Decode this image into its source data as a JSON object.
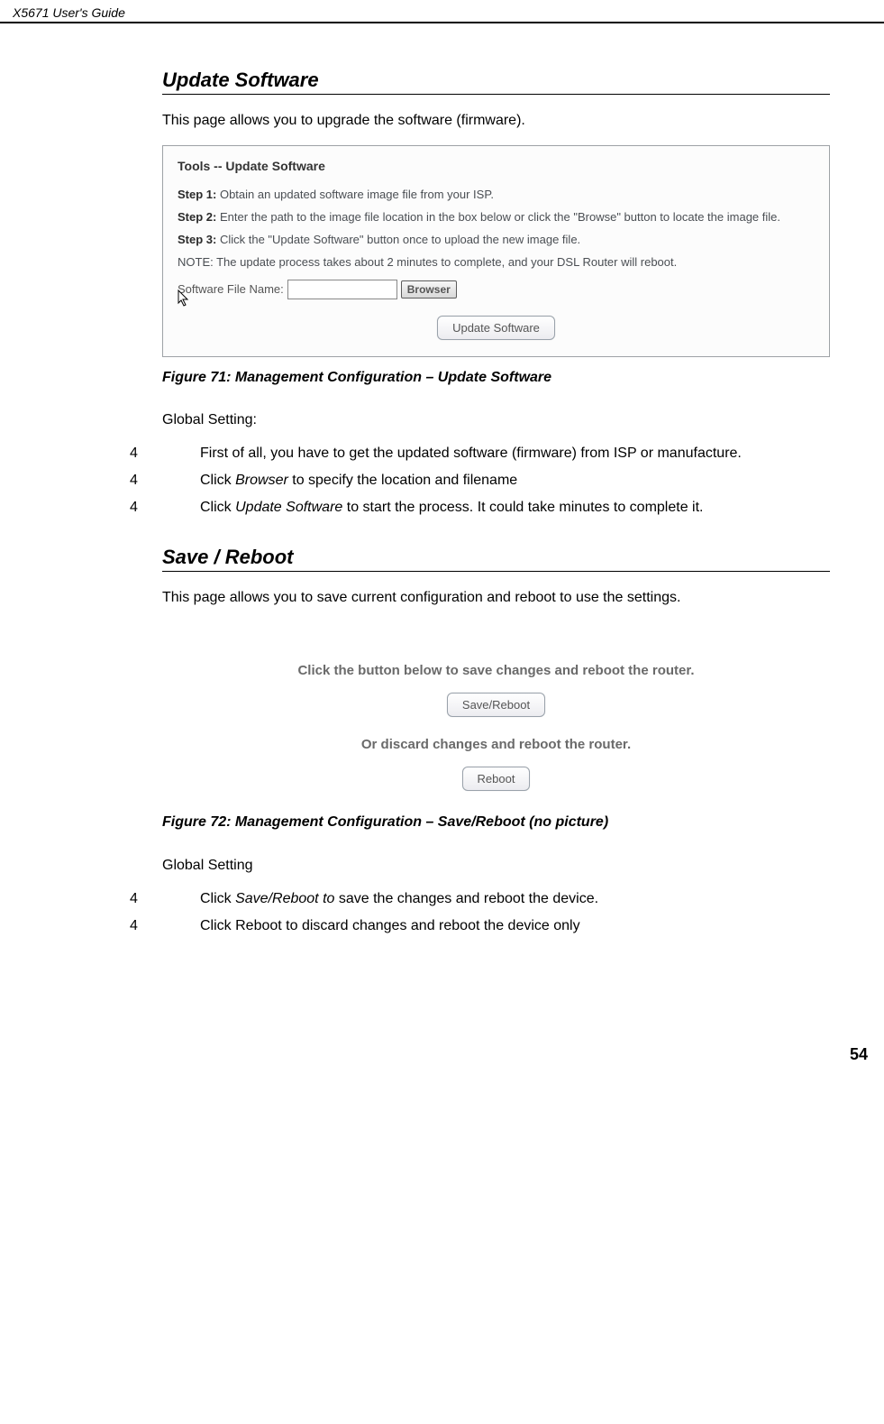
{
  "header": {
    "left": "X5671 User's Guide",
    "right": ""
  },
  "pageNumber": "54",
  "sections": {
    "updateSoftware": {
      "heading": "Update Software",
      "intro": "This page allows you to upgrade the software (firmware).",
      "screenshot": {
        "title": "Tools -- Update Software",
        "step1_label": "Step 1:",
        "step1_text": "Obtain an updated software image file from your ISP.",
        "step2_label": "Step 2:",
        "step2_text": "Enter the path to the image file location in the box below or click the \"Browse\" button to locate the image file.",
        "step3_label": "Step 3:",
        "step3_text": "Click the \"Update Software\" button once to upload the new image file.",
        "note": "NOTE: The update process takes about 2 minutes to complete, and your DSL Router will reboot.",
        "filefield_label": "Software File Name:",
        "browse_button": "Browser",
        "update_button": "Update Software"
      },
      "figureCaption": "Figure 71: Management Configuration – Update Software",
      "globalSettingLabel": "Global Setting:",
      "steps": [
        {
          "num": "4",
          "prefix": "First of all, you have to get the updated software (firmware) from ISP or manufacture.",
          "italic": "",
          "suffix": ""
        },
        {
          "num": "4",
          "prefix": "Click ",
          "italic": "Browser",
          "suffix": " to specify the location and filename"
        },
        {
          "num": "4",
          "prefix": "Click ",
          "italic": "Update Software",
          "suffix": " to start the process. It could take minutes to complete it."
        }
      ]
    },
    "saveReboot": {
      "heading": "Save / Reboot",
      "intro": "This page allows you to save current configuration and reboot to use the settings.",
      "screenshot": {
        "line1": "Click the button below to save changes and reboot the router.",
        "btn1": "Save/Reboot",
        "line2": "Or discard changes and reboot the router.",
        "btn2": "Reboot"
      },
      "figureCaption": "Figure 72: Management Configuration – Save/Reboot (no picture)",
      "globalSettingLabel": "Global Setting",
      "steps": [
        {
          "num": "4",
          "prefix": "Click ",
          "italic": "Save/Reboot to",
          "suffix": " save the changes and reboot the device."
        },
        {
          "num": "4",
          "prefix": "Click Reboot to discard changes and reboot the device only",
          "italic": "",
          "suffix": ""
        }
      ]
    }
  }
}
